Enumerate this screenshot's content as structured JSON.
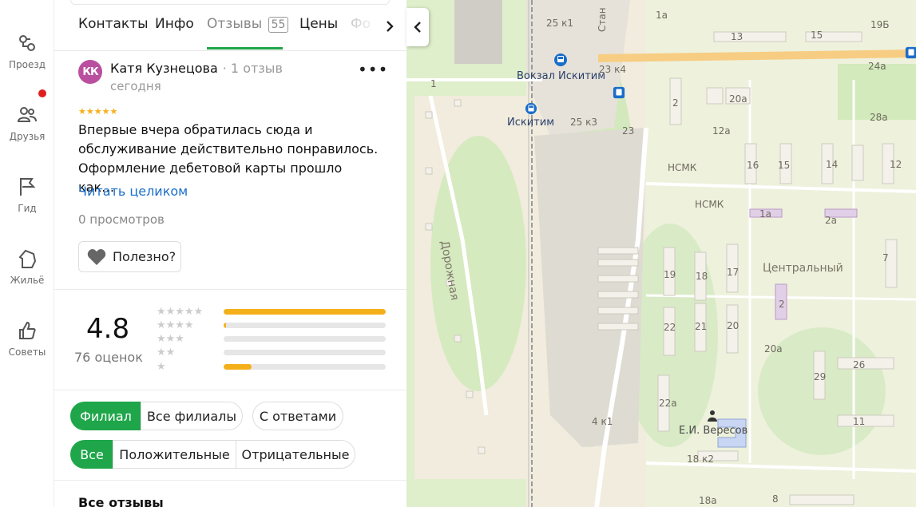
{
  "rail": {
    "items": [
      {
        "label": "Проезд",
        "icon": "route-icon"
      },
      {
        "label": "Друзья",
        "icon": "friends-icon"
      },
      {
        "label": "Гид",
        "icon": "flag-icon"
      },
      {
        "label": "Жильё",
        "icon": "home-icon"
      },
      {
        "label": "Советы",
        "icon": "thumbs-up-icon"
      }
    ]
  },
  "tabs": {
    "items": [
      "Контакты",
      "Инфо",
      "Отзывы",
      "Цены",
      "Фо"
    ],
    "reviews_count": "55",
    "active": "Отзывы"
  },
  "review": {
    "avatar_initials": "КК",
    "author": "Катя Кузнецова",
    "author_meta": "· 1 отзыв",
    "date": "сегодня",
    "stars": "★★★★★",
    "text": "Впервые вчера обратилась сюда и обслуживание действительно понравилось. Оформление дебетовой карты прошло как…",
    "read_more": "Читать целиком",
    "views": "0 просмотров",
    "useful_label": "Полезно?"
  },
  "rating": {
    "value": "4.8",
    "count_label": "76 оценок",
    "distribution": [
      {
        "stars": "★★★★★",
        "fraction": 1.0
      },
      {
        "stars": "★★★★",
        "fraction": 0.015
      },
      {
        "stars": "★★★",
        "fraction": 0.0
      },
      {
        "stars": "★★",
        "fraction": 0.0
      },
      {
        "stars": "★",
        "fraction": 0.17
      }
    ]
  },
  "filters": {
    "scope": [
      "Филиал",
      "Все филиалы"
    ],
    "with_answers": "С ответами",
    "sentiment": [
      "Все",
      "Положительные",
      "Отрицательные"
    ]
  },
  "all_reviews_heading": "Все отзывы",
  "map": {
    "labels": {
      "stan": "Стан",
      "b25k1": "25 к1",
      "b1a": "1а",
      "b19b": "19Б",
      "b13": "13",
      "b15": "15",
      "vokzal": "Вокзал Искитим",
      "b23k4": "23 к4",
      "b24a": "24а",
      "b2": "2",
      "b20a": "20а",
      "b28a": "28а",
      "iskitim": "Искитим",
      "b25k3": "25 к3",
      "b23": "23",
      "b12a": "12а",
      "b1": "1",
      "nsmk1": "НСМК",
      "nsmk2": "НСМК",
      "b16": "16",
      "b15b": "15",
      "b14": "14",
      "b12": "12",
      "b1a2": "1а",
      "b2a": "2а",
      "dorozhnaya": "Дорожная",
      "centralny": "Центральный",
      "b7": "7",
      "b19": "19",
      "b18": "18",
      "b17": "17",
      "b2c": "2",
      "b22": "22",
      "b21": "21",
      "b20": "20",
      "b20a2": "20а",
      "b26": "26",
      "b29": "29",
      "b22a": "22а",
      "b4k1": "4 к1",
      "veresov": "Е.И. Вересов",
      "b11": "11",
      "b18k2": "18 к2",
      "b18a": "18а",
      "b8": "8"
    }
  }
}
